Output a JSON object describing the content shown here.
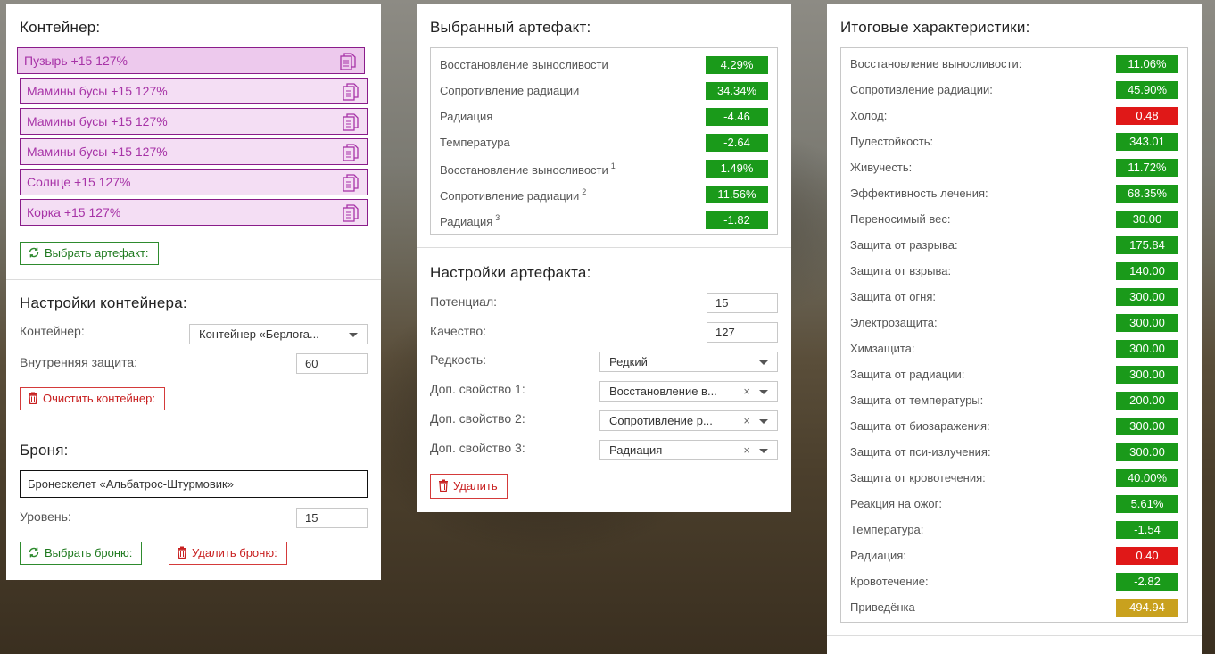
{
  "container_panel": {
    "title": "Контейнер:",
    "items": [
      {
        "label": "Пузырь +15 127%",
        "selected": true
      },
      {
        "label": "Мамины бусы +15 127%",
        "selected": false
      },
      {
        "label": "Мамины бусы +15 127%",
        "selected": false
      },
      {
        "label": "Мамины бусы +15 127%",
        "selected": false
      },
      {
        "label": "Солнце +15 127%",
        "selected": false
      },
      {
        "label": "Корка +15 127%",
        "selected": false
      }
    ],
    "select_artifact_label": "Выбрать артефакт:",
    "settings_title": "Настройки контейнера:",
    "container_label": "Контейнер:",
    "container_value": "Контейнер «Берлога...",
    "inner_protection_label": "Внутренняя защита:",
    "inner_protection_value": "60",
    "clear_label": "Очистить контейнер:",
    "armor_title": "Броня:",
    "armor_value": "Бронескелет «Альбатрос-Штурмовик»",
    "level_label": "Уровень:",
    "level_value": "15",
    "select_armor_label": "Выбрать броню:",
    "delete_armor_label": "Удалить броню:"
  },
  "artifact_panel": {
    "title": "Выбранный артефакт:",
    "stats": [
      {
        "name": "Восстановление выносливости",
        "sup": "",
        "value": "4.29%",
        "color": "#1a9a1a"
      },
      {
        "name": "Сопротивление радиации",
        "sup": "",
        "value": "34.34%",
        "color": "#1a9a1a"
      },
      {
        "name": "Радиация",
        "sup": "",
        "value": "-4.46",
        "color": "#1a9a1a"
      },
      {
        "name": "Температура",
        "sup": "",
        "value": "-2.64",
        "color": "#1a9a1a"
      },
      {
        "name": "Восстановление выносливости",
        "sup": "1",
        "value": "1.49%",
        "color": "#1a9a1a"
      },
      {
        "name": "Сопротивление радиации",
        "sup": "2",
        "value": "11.56%",
        "color": "#1a9a1a"
      },
      {
        "name": "Радиация",
        "sup": "3",
        "value": "-1.82",
        "color": "#1a9a1a"
      }
    ],
    "settings_title": "Настройки артефакта:",
    "potential_label": "Потенциал:",
    "potential_value": "15",
    "quality_label": "Качество:",
    "quality_value": "127",
    "rarity_label": "Редкость:",
    "rarity_value": "Редкий",
    "extra1_label": "Доп. свойство 1:",
    "extra1_value": "Восстановление в...",
    "extra2_label": "Доп. свойство 2:",
    "extra2_value": "Сопротивление р...",
    "extra3_label": "Доп. свойство 3:",
    "extra3_value": "Радиация",
    "clear_symbol": "×",
    "delete_label": "Удалить"
  },
  "totals_panel": {
    "title": "Итоговые характеристики:",
    "stats": [
      {
        "name": "Восстановление выносливости:",
        "value": "11.06%",
        "color": "#1a9a1a"
      },
      {
        "name": "Сопротивление радиации:",
        "value": "45.90%",
        "color": "#1a9a1a"
      },
      {
        "name": "Холод:",
        "value": "0.48",
        "color": "#e01818"
      },
      {
        "name": "Пулестойкость:",
        "value": "343.01",
        "color": "#1a9a1a"
      },
      {
        "name": "Живучесть:",
        "value": "11.72%",
        "color": "#1a9a1a"
      },
      {
        "name": "Эффективность лечения:",
        "value": "68.35%",
        "color": "#1a9a1a"
      },
      {
        "name": "Переносимый вес:",
        "value": "30.00",
        "color": "#1a9a1a"
      },
      {
        "name": "Защита от разрыва:",
        "value": "175.84",
        "color": "#1a9a1a"
      },
      {
        "name": "Защита от взрыва:",
        "value": "140.00",
        "color": "#1a9a1a"
      },
      {
        "name": "Защита от огня:",
        "value": "300.00",
        "color": "#1a9a1a"
      },
      {
        "name": "Электрозащита:",
        "value": "300.00",
        "color": "#1a9a1a"
      },
      {
        "name": "Химзащита:",
        "value": "300.00",
        "color": "#1a9a1a"
      },
      {
        "name": "Защита от радиации:",
        "value": "300.00",
        "color": "#1a9a1a"
      },
      {
        "name": "Защита от температуры:",
        "value": "200.00",
        "color": "#1a9a1a"
      },
      {
        "name": "Защита от биозаражения:",
        "value": "300.00",
        "color": "#1a9a1a"
      },
      {
        "name": "Защита от пси-излучения:",
        "value": "300.00",
        "color": "#1a9a1a"
      },
      {
        "name": "Защита от кровотечения:",
        "value": "40.00%",
        "color": "#1a9a1a"
      },
      {
        "name": "Реакция на ожог:",
        "value": "5.61%",
        "color": "#1a9a1a"
      },
      {
        "name": "Температура:",
        "value": "-1.54",
        "color": "#1a9a1a"
      },
      {
        "name": "Радиация:",
        "value": "0.40",
        "color": "#e01818"
      },
      {
        "name": "Кровотечение:",
        "value": "-2.82",
        "color": "#1a9a1a"
      },
      {
        "name": "Приведёнка",
        "value": "494.94",
        "color": "#c9a11e"
      }
    ]
  },
  "icons": {
    "copy": "copy-icon",
    "refresh": "refresh-icon",
    "trash": "trash-icon",
    "dropdown": "chevron-down-icon"
  }
}
